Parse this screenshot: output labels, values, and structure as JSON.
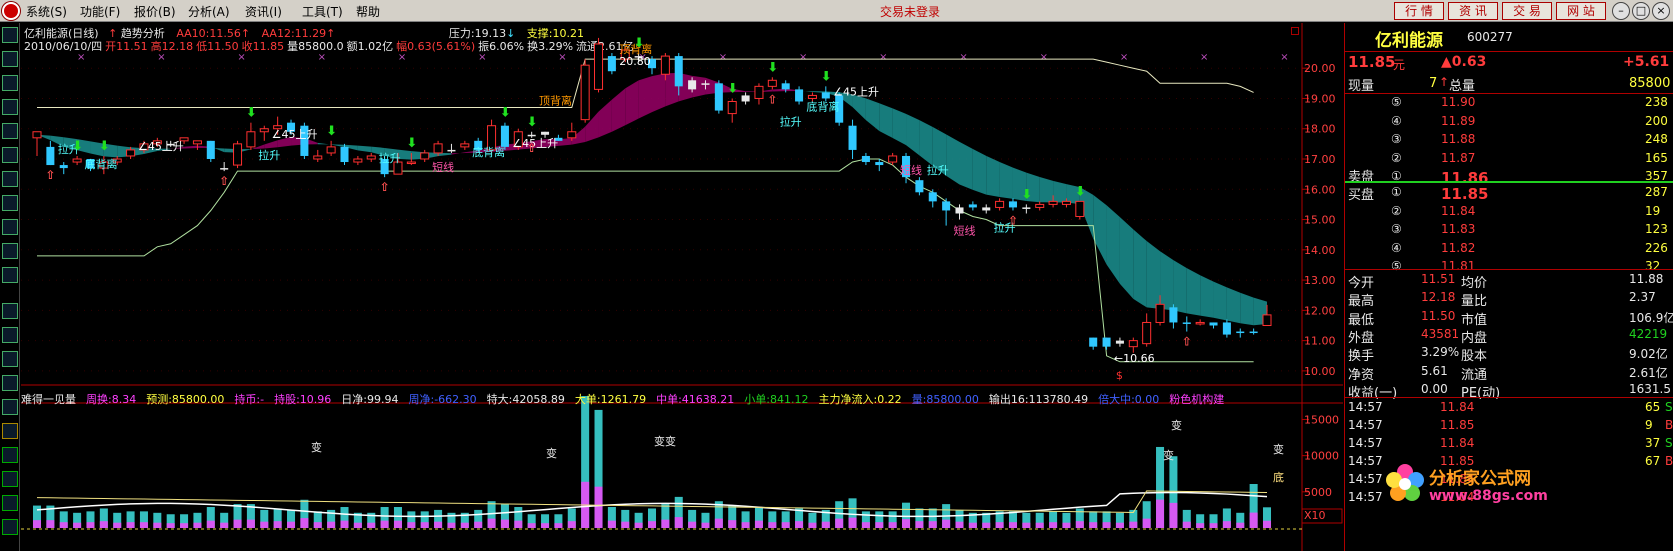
{
  "menu": {
    "items": [
      "系统(S)",
      "功能(F)",
      "报价(B)",
      "分析(A)",
      "资讯(I)",
      "工具(T)",
      "帮助"
    ],
    "status": "交易未登录",
    "buttons": [
      "行 情",
      "资 讯",
      "交 易",
      "网 站"
    ]
  },
  "chart_header": {
    "title": "亿利能源(日线)",
    "indicator": "趋势分析",
    "aa10": "AA10:11.56",
    "aa12": "AA12:11.29",
    "pressure": "压力:19.13",
    "support": "支撑:10.21",
    "info": [
      {
        "t": "2010/06/10/四",
        "c": "#e8e8e8"
      },
      {
        "t": "开11.51",
        "c": "#ff3c3c"
      },
      {
        "t": "高12.18",
        "c": "#ff3c3c"
      },
      {
        "t": "低11.50",
        "c": "#ff3c3c"
      },
      {
        "t": "收11.85",
        "c": "#ff3c3c"
      },
      {
        "t": "量85800.0",
        "c": "#e8e8e8"
      },
      {
        "t": "额1.02亿",
        "c": "#e8e8e8"
      },
      {
        "t": "幅0.63(5.61%)",
        "c": "#ff3c3c"
      },
      {
        "t": "振6.06%",
        "c": "#e8e8e8"
      },
      {
        "t": "换3.29%",
        "c": "#e8e8e8"
      },
      {
        "t": "流通2.61亿",
        "c": "#e8e8e8"
      }
    ]
  },
  "chart_data": {
    "type": "candlestick",
    "title": "亿利能源(日线)",
    "y_ticks": [
      "20.00",
      "19.00",
      "18.00",
      "17.00",
      "16.00",
      "15.00",
      "14.00",
      "13.00",
      "12.00",
      "11.00",
      "10.00"
    ],
    "ylim": [
      9.6,
      20.7
    ],
    "candles": [
      [
        17.7,
        17.9,
        17.9,
        17.1,
        "r"
      ],
      [
        17.4,
        16.8,
        17.6,
        16.8,
        "g"
      ],
      [
        16.8,
        16.7,
        16.9,
        16.5,
        "g"
      ],
      [
        16.9,
        17.0,
        17.1,
        16.8,
        "r"
      ],
      [
        17.0,
        16.7,
        17.0,
        16.6,
        "g"
      ],
      [
        16.7,
        16.9,
        17.1,
        16.5,
        "r"
      ],
      [
        16.9,
        17.0,
        17.1,
        16.8,
        "r"
      ],
      [
        17.1,
        17.3,
        17.4,
        17.0,
        "r"
      ],
      [
        17.3,
        17.5,
        17.6,
        17.2,
        "r"
      ],
      [
        17.5,
        17.6,
        17.7,
        17.4,
        "r"
      ],
      [
        17.5,
        17.5,
        17.6,
        17.4,
        "n"
      ],
      [
        17.6,
        17.7,
        17.7,
        17.5,
        "r"
      ],
      [
        17.5,
        17.6,
        17.6,
        17.3,
        "r"
      ],
      [
        17.6,
        17.0,
        17.6,
        16.9,
        "g"
      ],
      [
        16.7,
        16.7,
        16.9,
        16.6,
        "n"
      ],
      [
        16.8,
        17.5,
        17.6,
        16.7,
        "r"
      ],
      [
        17.4,
        17.9,
        18.2,
        17.3,
        "r"
      ],
      [
        17.9,
        18.0,
        18.1,
        17.6,
        "r"
      ],
      [
        18.0,
        18.1,
        18.4,
        17.8,
        "r"
      ],
      [
        18.2,
        17.9,
        18.3,
        17.8,
        "g"
      ],
      [
        18.1,
        17.1,
        18.2,
        17.0,
        "g"
      ],
      [
        17.0,
        17.1,
        17.3,
        16.9,
        "r"
      ],
      [
        17.2,
        17.4,
        17.6,
        17.1,
        "r"
      ],
      [
        17.4,
        16.9,
        17.5,
        16.8,
        "g"
      ],
      [
        16.9,
        17.0,
        17.1,
        16.8,
        "r"
      ],
      [
        17.0,
        17.1,
        17.2,
        16.9,
        "r"
      ],
      [
        17.0,
        16.5,
        17.1,
        16.4,
        "g"
      ],
      [
        16.5,
        16.9,
        17.2,
        16.5,
        "r"
      ],
      [
        16.9,
        16.9,
        17.2,
        16.8,
        "r"
      ],
      [
        17.0,
        17.2,
        17.3,
        16.9,
        "r"
      ],
      [
        17.2,
        17.5,
        17.6,
        17.1,
        "r"
      ],
      [
        17.3,
        17.3,
        17.5,
        17.2,
        "n"
      ],
      [
        17.4,
        17.5,
        17.6,
        17.3,
        "r"
      ],
      [
        17.6,
        17.3,
        17.7,
        17.2,
        "g"
      ],
      [
        17.3,
        18.1,
        18.3,
        17.2,
        "r"
      ],
      [
        18.1,
        17.4,
        18.2,
        17.3,
        "g"
      ],
      [
        17.4,
        17.9,
        18.0,
        17.3,
        "r"
      ],
      [
        17.8,
        17.8,
        17.9,
        17.7,
        "n"
      ],
      [
        17.8,
        17.9,
        17.9,
        17.7,
        "n"
      ],
      [
        17.7,
        17.6,
        17.8,
        17.6,
        "g"
      ],
      [
        17.7,
        17.9,
        18.2,
        17.6,
        "r"
      ],
      [
        18.3,
        20.1,
        20.3,
        18.2,
        "r"
      ],
      [
        19.3,
        20.8,
        21.0,
        19.2,
        "r"
      ],
      [
        20.4,
        19.9,
        20.5,
        19.8,
        "g"
      ],
      [
        20.3,
        20.6,
        20.7,
        20.2,
        "r"
      ],
      [
        20.4,
        20.4,
        20.5,
        20.2,
        "n"
      ],
      [
        20.3,
        20.0,
        20.4,
        19.8,
        "g"
      ],
      [
        19.8,
        20.4,
        20.5,
        19.6,
        "r"
      ],
      [
        20.4,
        19.4,
        20.5,
        19.1,
        "g"
      ],
      [
        19.3,
        19.6,
        19.7,
        19.2,
        "n"
      ],
      [
        19.5,
        19.5,
        19.6,
        19.3,
        "n"
      ],
      [
        19.5,
        18.6,
        19.6,
        18.5,
        "g"
      ],
      [
        18.5,
        18.9,
        19.0,
        18.2,
        "r"
      ],
      [
        18.9,
        19.1,
        19.2,
        18.8,
        "n"
      ],
      [
        19.0,
        19.4,
        19.5,
        18.8,
        "r"
      ],
      [
        19.4,
        19.6,
        19.7,
        19.3,
        "r"
      ],
      [
        19.5,
        19.3,
        19.6,
        19.2,
        "g"
      ],
      [
        19.3,
        18.9,
        19.4,
        18.8,
        "g"
      ],
      [
        19.0,
        19.1,
        19.2,
        18.9,
        "r"
      ],
      [
        19.2,
        19.0,
        19.4,
        18.9,
        "g"
      ],
      [
        19.1,
        18.2,
        19.2,
        18.1,
        "g"
      ],
      [
        18.1,
        17.3,
        18.3,
        17.0,
        "g"
      ],
      [
        17.1,
        16.9,
        17.2,
        16.8,
        "g"
      ],
      [
        16.9,
        16.8,
        17.0,
        16.6,
        "g"
      ],
      [
        16.9,
        17.1,
        17.2,
        16.8,
        "r"
      ],
      [
        17.1,
        16.4,
        17.2,
        16.2,
        "g"
      ],
      [
        16.3,
        15.9,
        16.4,
        15.8,
        "g"
      ],
      [
        15.9,
        15.6,
        16.0,
        15.4,
        "g"
      ],
      [
        15.6,
        15.3,
        15.7,
        14.8,
        "g"
      ],
      [
        15.2,
        15.4,
        15.5,
        15.0,
        "n"
      ],
      [
        15.5,
        15.4,
        15.6,
        15.3,
        "g"
      ],
      [
        15.4,
        15.3,
        15.5,
        15.2,
        "n"
      ],
      [
        15.4,
        15.6,
        15.7,
        15.3,
        "r"
      ],
      [
        15.6,
        15.4,
        15.7,
        15.3,
        "g"
      ],
      [
        15.4,
        15.4,
        15.5,
        15.2,
        "n"
      ],
      [
        15.4,
        15.5,
        15.6,
        15.3,
        "r"
      ],
      [
        15.5,
        15.6,
        15.8,
        15.4,
        "r"
      ],
      [
        15.6,
        15.5,
        15.7,
        15.4,
        "r"
      ],
      [
        15.6,
        15.1,
        15.6,
        15.0,
        "r"
      ],
      [
        11.1,
        10.8,
        11.1,
        10.7,
        "g"
      ],
      [
        11.1,
        10.8,
        11.1,
        10.7,
        "g"
      ],
      [
        10.9,
        11.0,
        11.1,
        10.8,
        "n"
      ],
      [
        11.0,
        10.8,
        11.1,
        10.6,
        "r"
      ],
      [
        10.9,
        11.6,
        11.9,
        10.8,
        "r"
      ],
      [
        11.6,
        12.2,
        12.5,
        11.5,
        "r"
      ],
      [
        12.1,
        11.6,
        12.2,
        11.4,
        "g"
      ],
      [
        11.6,
        11.6,
        11.8,
        11.3,
        "g"
      ],
      [
        11.6,
        11.6,
        11.7,
        11.5,
        "r"
      ],
      [
        11.6,
        11.5,
        11.6,
        11.4,
        "g"
      ],
      [
        11.6,
        11.2,
        11.7,
        11.1,
        "g"
      ],
      [
        11.3,
        11.3,
        11.4,
        11.1,
        "g"
      ],
      [
        11.3,
        11.3,
        11.4,
        11.2,
        "g"
      ],
      [
        11.5,
        11.85,
        12.18,
        11.5,
        "r"
      ]
    ],
    "upper_line": [
      18.7,
      18.7,
      18.7,
      18.7,
      18.7,
      18.7,
      18.7,
      18.7,
      18.7,
      18.7,
      18.7,
      18.7,
      18.7,
      18.7,
      18.7,
      18.7,
      18.7,
      18.7,
      18.7,
      18.7,
      18.7,
      18.7,
      18.7,
      18.7,
      18.7,
      18.7,
      18.7,
      18.7,
      18.7,
      18.7,
      18.7,
      18.7,
      18.7,
      18.7,
      18.7,
      18.7,
      18.7,
      18.7,
      18.7,
      18.7,
      18.7,
      20.3,
      20.3,
      20.3,
      20.3,
      20.3,
      20.3,
      20.3,
      20.3,
      20.3,
      20.3,
      20.3,
      20.3,
      20.3,
      20.3,
      20.3,
      20.3,
      20.3,
      20.3,
      20.3,
      20.3,
      20.3,
      20.3,
      20.3,
      20.3,
      20.3,
      20.3,
      20.3,
      20.3,
      20.3,
      20.3,
      20.3,
      20.3,
      20.3,
      20.3,
      20.3,
      20.3,
      20.3,
      20.3,
      20.3,
      20.2,
      20.1,
      20.0,
      19.9,
      19.5,
      19.5,
      19.5,
      19.5,
      19.5,
      19.5,
      19.4,
      19.2
    ],
    "lower_line": [
      13.8,
      13.8,
      13.8,
      13.8,
      13.8,
      13.8,
      13.8,
      13.8,
      13.8,
      14.1,
      14.2,
      14.5,
      14.8,
      15.3,
      15.9,
      16.6,
      16.6,
      16.6,
      16.6,
      16.6,
      16.6,
      16.6,
      16.6,
      16.6,
      16.6,
      16.6,
      16.6,
      16.6,
      16.6,
      16.6,
      16.6,
      16.6,
      16.6,
      16.6,
      16.6,
      16.6,
      16.6,
      16.6,
      16.6,
      16.6,
      16.6,
      16.6,
      16.6,
      16.6,
      16.6,
      16.6,
      16.6,
      16.6,
      16.6,
      16.6,
      16.6,
      16.6,
      16.6,
      16.6,
      16.6,
      16.6,
      16.6,
      16.6,
      16.6,
      16.6,
      16.6,
      16.9,
      17.0,
      17.0,
      16.8,
      16.4,
      16.1,
      15.9,
      15.6,
      15.3,
      15.1,
      15.0,
      14.8,
      14.8,
      14.8,
      14.8,
      14.8,
      14.8,
      14.8,
      14.8,
      10.5,
      10.3,
      10.3,
      10.3,
      10.3,
      10.3,
      10.3,
      10.3,
      10.3,
      10.3,
      10.3,
      10.3
    ],
    "labels": [
      {
        "i": 2,
        "p": 17.2,
        "t": "拉升",
        "c": "#5ff"
      },
      {
        "i": 4,
        "p": 16.7,
        "t": "底背离",
        "c": "#5ff"
      },
      {
        "i": 8,
        "p": 17.3,
        "t": "∠45上升",
        "c": "#fff"
      },
      {
        "i": 17,
        "p": 17.0,
        "t": "拉升",
        "c": "#5ff"
      },
      {
        "i": 18,
        "p": 17.7,
        "t": "∠45上升",
        "c": "#fff"
      },
      {
        "i": 26,
        "p": 16.9,
        "t": "拉升",
        "c": "#5ff"
      },
      {
        "i": 30,
        "p": 16.6,
        "t": "短线",
        "c": "#f5a"
      },
      {
        "i": 33,
        "p": 17.1,
        "t": "底背离",
        "c": "#5ff"
      },
      {
        "i": 36,
        "p": 17.4,
        "t": "∠45上升",
        "c": "#fff"
      },
      {
        "i": 38,
        "p": 18.8,
        "t": "顶背离",
        "c": "#f90"
      },
      {
        "i": 44,
        "p": 20.5,
        "t": "顶背离",
        "c": "#f90"
      },
      {
        "i": 44,
        "p": 20.1,
        "t": "20.80",
        "c": "#fff"
      },
      {
        "i": 56,
        "p": 18.1,
        "t": "拉升",
        "c": "#5ff"
      },
      {
        "i": 58,
        "p": 18.6,
        "t": "底背离",
        "c": "#5ff"
      },
      {
        "i": 60,
        "p": 19.1,
        "t": "∠45上升",
        "c": "#fff"
      },
      {
        "i": 65,
        "p": 16.5,
        "t": "短线",
        "c": "#f5a"
      },
      {
        "i": 67,
        "p": 16.5,
        "t": "拉升",
        "c": "#5ff"
      },
      {
        "i": 69,
        "p": 14.5,
        "t": "短线",
        "c": "#f5a"
      },
      {
        "i": 72,
        "p": 14.6,
        "t": "拉升",
        "c": "#5ff"
      },
      {
        "i": 81,
        "p": 10.3,
        "t": "←10.66",
        "c": "#fff"
      }
    ]
  },
  "volume_header": [
    {
      "t": "难得一见量",
      "c": "#e8e8e8"
    },
    {
      "t": "周换:8.34",
      "c": "#ff40ff"
    },
    {
      "t": "预测:85800.00",
      "c": "#ffff40"
    },
    {
      "t": "持币:-",
      "c": "#ff40ff"
    },
    {
      "t": "持股:10.96",
      "c": "#ff40ff"
    },
    {
      "t": "日净:99.94",
      "c": "#e8e8e8"
    },
    {
      "t": "周净:-662.30",
      "c": "#4060ff"
    },
    {
      "t": "特大:42058.89",
      "c": "#e8e8e8"
    },
    {
      "t": "大单:1261.79",
      "c": "#ffff40"
    },
    {
      "t": "中单:41638.21",
      "c": "#ff40ff"
    },
    {
      "t": "小单:841.12",
      "c": "#20d020"
    },
    {
      "t": "主力净流入:0.22",
      "c": "#ffff40"
    },
    {
      "t": "量:85800.00",
      "c": "#4060ff"
    },
    {
      "t": "输出16:113780.49",
      "c": "#e8e8e8"
    },
    {
      "t": "倍大中:0.00",
      "c": "#4060ff"
    },
    {
      "t": "粉色机构建",
      "c": "#ff40ff"
    }
  ],
  "vol_ticks": [
    "15000",
    "10000",
    "5000"
  ],
  "vol_unit": "X10",
  "vol_labels": [
    {
      "x": 290,
      "y": 428,
      "t": "变"
    },
    {
      "x": 525,
      "y": 434,
      "t": "变"
    },
    {
      "x": 633,
      "y": 422,
      "t": "变变"
    },
    {
      "x": 1150,
      "y": 406,
      "t": "变"
    },
    {
      "x": 1142,
      "y": 436,
      "t": "变"
    },
    {
      "x": 1252,
      "y": 430,
      "t": "变"
    },
    {
      "x": 1252,
      "y": 458,
      "t": "底"
    }
  ],
  "quote": {
    "name": "亿利能源",
    "code": "600277",
    "price": "11.85",
    "unit": "元",
    "change": "▲0.63",
    "pct": "+5.61",
    "xianliang_l": "现量",
    "xianliang": "7",
    "zongliang_l": "总量",
    "zongliang": "85800",
    "sells": [
      [
        "⑤",
        "11.90",
        "238"
      ],
      [
        "④",
        "11.89",
        "200"
      ],
      [
        "③",
        "11.88",
        "248"
      ],
      [
        "②",
        "11.87",
        "165"
      ],
      [
        "①",
        "11.86",
        "357"
      ]
    ],
    "sell_label": "卖盘",
    "buy_label": "买盘",
    "buys": [
      [
        "①",
        "11.85",
        "287"
      ],
      [
        "②",
        "11.84",
        "19"
      ],
      [
        "③",
        "11.83",
        "123"
      ],
      [
        "④",
        "11.82",
        "226"
      ],
      [
        "⑤",
        "11.81",
        "32"
      ]
    ],
    "stats": [
      [
        "今开",
        "11.51",
        "均价",
        "11.88"
      ],
      [
        "最高",
        "12.18",
        "量比",
        "2.37"
      ],
      [
        "最低",
        "11.50",
        "市值",
        "106.9亿"
      ],
      [
        "外盘",
        "43581",
        "内盘",
        "42219"
      ],
      [
        "换手",
        "3.29%",
        "股本",
        "9.02亿"
      ],
      [
        "净资",
        "5.61",
        "流通",
        "2.61亿"
      ],
      [
        "收益(一)",
        "0.00",
        "PE(动)",
        "1631.5"
      ]
    ],
    "ticks": [
      [
        "14:57",
        "11.84",
        "65",
        "S"
      ],
      [
        "14:57",
        "11.85",
        "9",
        "B"
      ],
      [
        "14:57",
        "11.84",
        "37",
        "S"
      ],
      [
        "14:57",
        "11.85",
        "67",
        "B"
      ],
      [
        "14:57",
        "11.84",
        "",
        ""
      ],
      [
        "14:57",
        "11.84",
        "",
        ""
      ]
    ],
    "watermark1": "分析家公式网",
    "watermark2": "www.88gs.com"
  }
}
